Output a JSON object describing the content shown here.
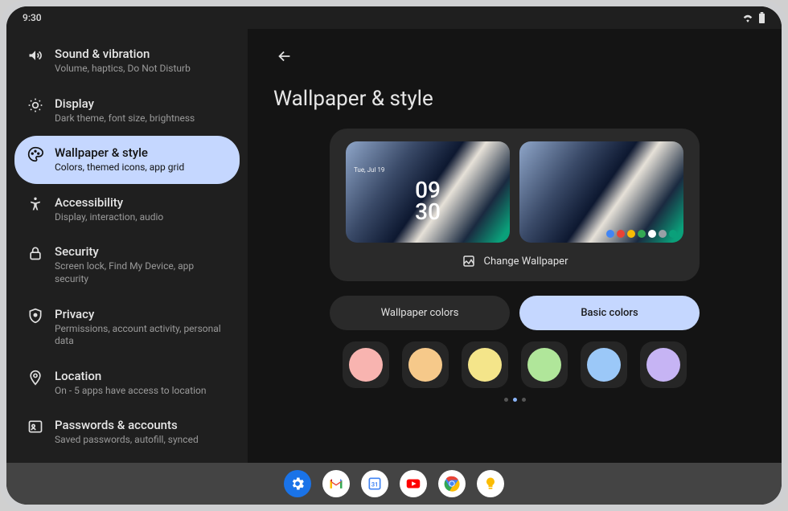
{
  "status": {
    "time": "9:30"
  },
  "sidebar": {
    "items": [
      {
        "title": "Sound & vibration",
        "sub": "Volume, haptics, Do Not Disturb"
      },
      {
        "title": "Display",
        "sub": "Dark theme, font size, brightness"
      },
      {
        "title": "Wallpaper & style",
        "sub": "Colors, themed icons, app grid"
      },
      {
        "title": "Accessibility",
        "sub": "Display, interaction, audio"
      },
      {
        "title": "Security",
        "sub": "Screen lock, Find My Device, app security"
      },
      {
        "title": "Privacy",
        "sub": "Permissions, account activity, personal data"
      },
      {
        "title": "Location",
        "sub": "On - 5 apps have access to location"
      },
      {
        "title": "Passwords & accounts",
        "sub": "Saved passwords, autofill, synced"
      }
    ],
    "active_index": 2
  },
  "page": {
    "title": "Wallpaper & style"
  },
  "change_wallpaper": "Change Wallpaper",
  "lock_preview": {
    "date": "Tue, Jul 19",
    "clock1": "09",
    "clock2": "30"
  },
  "tabs": {
    "wallpaper": "Wallpaper colors",
    "basic": "Basic colors",
    "active": "basic"
  },
  "swatches": [
    "#f8b4b0",
    "#f6c98a",
    "#f4e58a",
    "#b0e69a",
    "#9bc8f8",
    "#c6b4f4"
  ],
  "pager": {
    "count": 3,
    "active": 1
  },
  "dock_apps": [
    {
      "name": "settings",
      "bg": "#1a73e8"
    },
    {
      "name": "gmail",
      "bg": "#ffffff"
    },
    {
      "name": "calendar",
      "bg": "#ffffff"
    },
    {
      "name": "youtube",
      "bg": "#ffffff"
    },
    {
      "name": "chrome",
      "bg": "#ffffff"
    },
    {
      "name": "keep",
      "bg": "#ffffff"
    }
  ]
}
